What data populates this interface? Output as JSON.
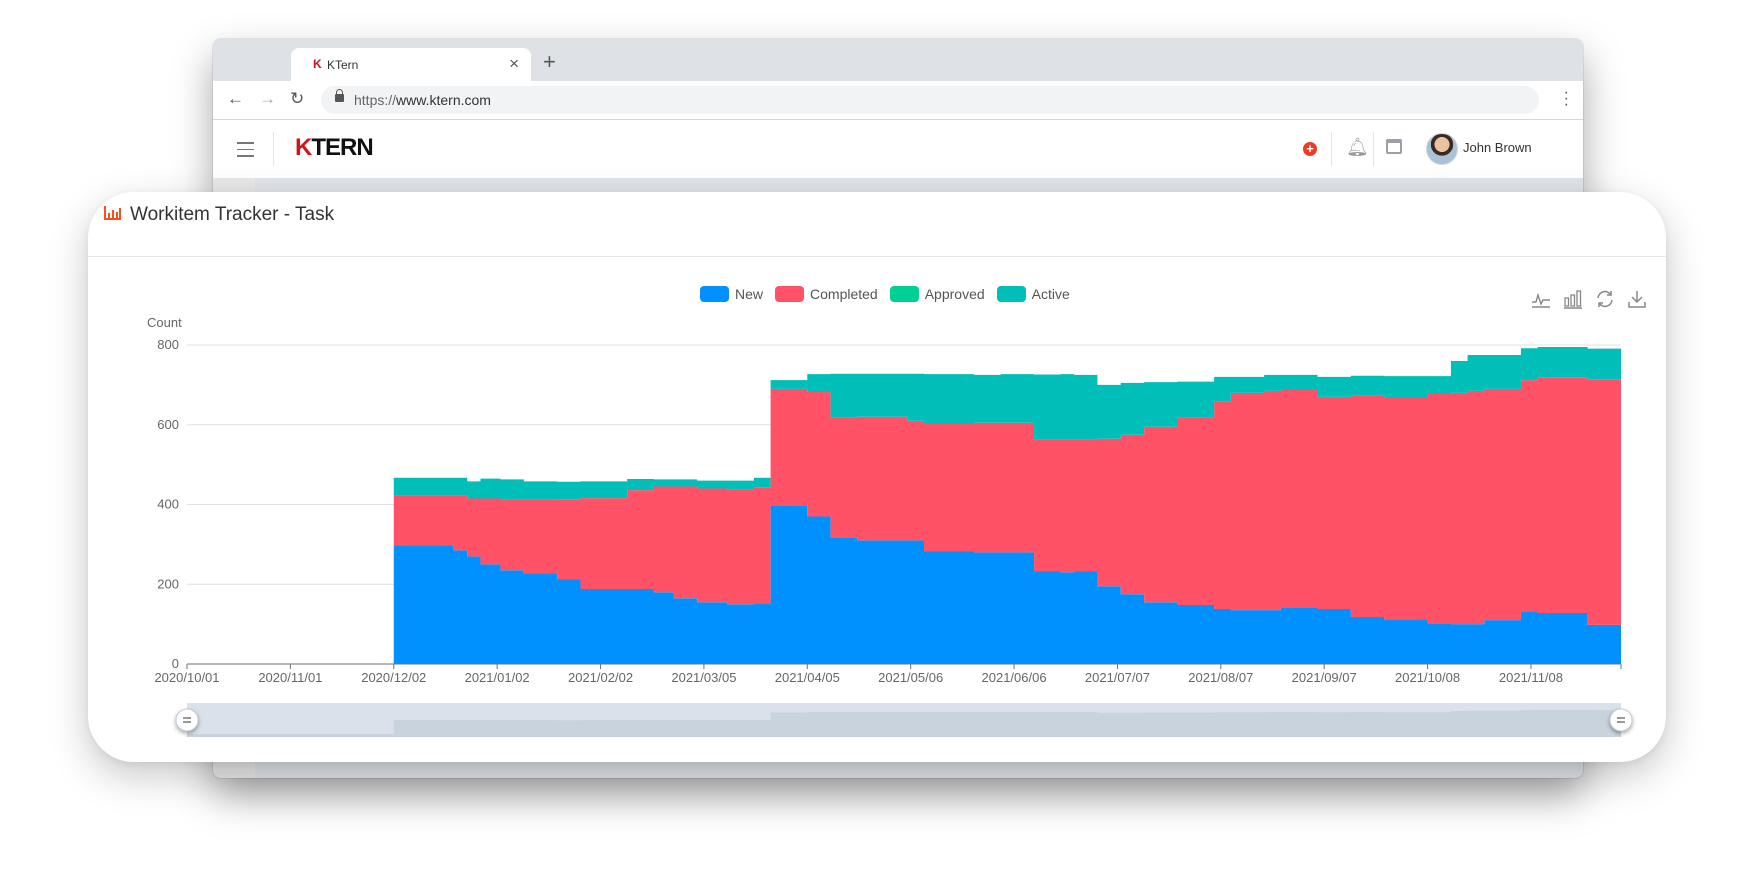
{
  "browser": {
    "tab_title": "KTern",
    "tab_favicon": "ktern-k-icon",
    "url_protocol": "https://",
    "url_host": "www.ktern.com",
    "traffic_lights": [
      "#ee5f57",
      "#f6be3b",
      "#5cc73f"
    ]
  },
  "app_header": {
    "logo_k": "K",
    "logo_rest": "TERN",
    "user_name": "John Brown",
    "icons": [
      "menu-icon",
      "add-icon",
      "bell-icon",
      "calendar-icon",
      "avatar"
    ]
  },
  "card": {
    "title": "Workitem Tracker - Task",
    "title_icon": "bar-chart-icon",
    "accent_color": "#f4511e",
    "toolbox": [
      {
        "name": "line-chart-toggle",
        "icon": "line-chart-icon"
      },
      {
        "name": "bar-chart-toggle",
        "icon": "bar-chart-icon"
      },
      {
        "name": "restore",
        "icon": "refresh-icon"
      },
      {
        "name": "save-image",
        "icon": "download-icon"
      }
    ]
  },
  "chart_data": {
    "type": "area",
    "stacked": true,
    "step": true,
    "title": "Workitem Tracker - Task",
    "xlabel": "",
    "ylabel": "Count",
    "ylim": [
      0,
      800
    ],
    "yticks": [
      0,
      200,
      400,
      600,
      800
    ],
    "xlim": [
      "2020/10/01",
      "2021/12/05"
    ],
    "xticks": [
      "2020/10/01",
      "2020/11/01",
      "2020/12/02",
      "2021/01/02",
      "2021/02/02",
      "2021/03/05",
      "2021/04/05",
      "2021/05/06",
      "2021/06/06",
      "2021/07/07",
      "2021/08/07",
      "2021/09/07",
      "2021/10/08",
      "2021/11/08"
    ],
    "grid": true,
    "legend_position": "top-center",
    "series_meta": [
      {
        "name": "New",
        "color": "#0091ff"
      },
      {
        "name": "Completed",
        "color": "#ff5266"
      },
      {
        "name": "Approved",
        "color": "#00d094"
      },
      {
        "name": "Active",
        "color": "#00bfb8"
      }
    ],
    "x": [
      "2020/12/02",
      "2020/12/20",
      "2020/12/24",
      "2020/12/28",
      "2021/01/03",
      "2021/01/10",
      "2021/01/20",
      "2021/01/27",
      "2021/02/10",
      "2021/02/18",
      "2021/02/24",
      "2021/03/03",
      "2021/03/12",
      "2021/03/20",
      "2021/03/25",
      "2021/04/05",
      "2021/04/12",
      "2021/04/20",
      "2021/05/05",
      "2021/05/10",
      "2021/05/25",
      "2021/06/02",
      "2021/06/12",
      "2021/06/20",
      "2021/06/24",
      "2021/07/01",
      "2021/07/08",
      "2021/07/15",
      "2021/07/25",
      "2021/08/05",
      "2021/08/10",
      "2021/08/20",
      "2021/08/25",
      "2021/09/05",
      "2021/09/15",
      "2021/09/25",
      "2021/10/08",
      "2021/10/15",
      "2021/10/20",
      "2021/10/25",
      "2021/11/05",
      "2021/11/10",
      "2021/11/25",
      "2021/12/05"
    ],
    "series": [
      {
        "name": "New",
        "values": [
          298,
          285,
          270,
          250,
          235,
          228,
          212,
          188,
          188,
          180,
          165,
          155,
          150,
          152,
          398,
          370,
          318,
          310,
          310,
          282,
          280,
          280,
          232,
          230,
          232,
          195,
          175,
          155,
          148,
          138,
          135,
          135,
          142,
          138,
          118,
          112,
          102,
          100,
          100,
          110,
          132,
          128,
          98,
          98
        ]
      },
      {
        "name": "Completed",
        "values": [
          125,
          138,
          145,
          165,
          178,
          185,
          200,
          228,
          248,
          265,
          280,
          285,
          288,
          290,
          292,
          312,
          300,
          310,
          300,
          320,
          325,
          325,
          330,
          332,
          330,
          370,
          400,
          440,
          470,
          520,
          545,
          550,
          545,
          532,
          555,
          555,
          575,
          580,
          585,
          580,
          580,
          590,
          615,
          615
        ]
      },
      {
        "name": "Approved",
        "values": [
          0,
          0,
          0,
          0,
          0,
          0,
          0,
          0,
          0,
          0,
          0,
          0,
          0,
          0,
          0,
          0,
          0,
          0,
          0,
          0,
          0,
          0,
          0,
          0,
          0,
          0,
          0,
          0,
          0,
          0,
          0,
          0,
          0,
          0,
          0,
          0,
          0,
          0,
          0,
          0,
          0,
          0,
          0,
          0
        ]
      },
      {
        "name": "Active",
        "values": [
          44,
          44,
          43,
          50,
          50,
          45,
          45,
          42,
          28,
          18,
          18,
          20,
          22,
          25,
          22,
          45,
          110,
          108,
          118,
          125,
          120,
          122,
          164,
          165,
          163,
          135,
          130,
          112,
          90,
          62,
          40,
          40,
          38,
          50,
          50,
          55,
          45,
          80,
          90,
          85,
          80,
          77,
          78,
          78
        ]
      }
    ]
  },
  "data_zoom": {
    "start_percent": 0,
    "end_percent": 100
  }
}
